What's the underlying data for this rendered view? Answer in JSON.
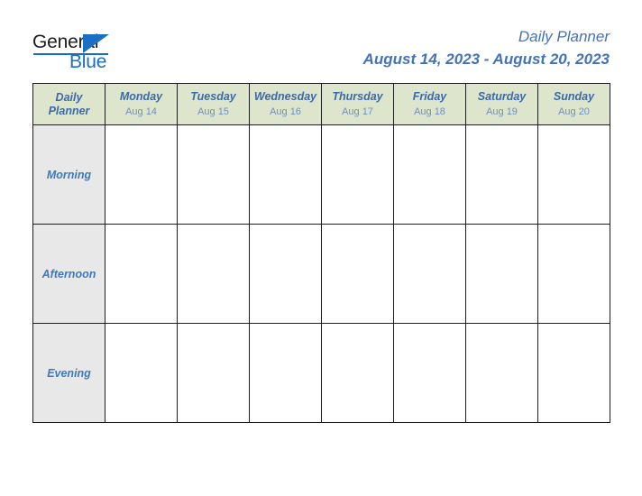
{
  "logo": {
    "word_primary": "General",
    "word_secondary": "Blue",
    "triangle_icon": "triangle-icon",
    "primary_color": "#1c1c1c",
    "accent_color": "#1a6fc4"
  },
  "header": {
    "title": "Daily Planner",
    "subtitle": "August 14, 2023 - August 20, 2023",
    "title_color": "#4472b8"
  },
  "planner": {
    "corner_label_line1": "Daily",
    "corner_label_line2": "Planner",
    "header_background": "#dde5cc",
    "row_label_background": "#e8e8e8",
    "cell_background": "#ffffff",
    "border_color": "#1d1d1d",
    "columns": [
      {
        "day": "Monday",
        "date": "Aug 14"
      },
      {
        "day": "Tuesday",
        "date": "Aug 15"
      },
      {
        "day": "Wednesday",
        "date": "Aug 16"
      },
      {
        "day": "Thursday",
        "date": "Aug 17"
      },
      {
        "day": "Friday",
        "date": "Aug 18"
      },
      {
        "day": "Saturday",
        "date": "Aug 19"
      },
      {
        "day": "Sunday",
        "date": "Aug 20"
      }
    ],
    "rows": [
      {
        "label": "Morning",
        "cells": [
          "",
          "",
          "",
          "",
          "",
          "",
          ""
        ]
      },
      {
        "label": "Afternoon",
        "cells": [
          "",
          "",
          "",
          "",
          "",
          "",
          ""
        ]
      },
      {
        "label": "Evening",
        "cells": [
          "",
          "",
          "",
          "",
          "",
          "",
          ""
        ]
      }
    ]
  }
}
